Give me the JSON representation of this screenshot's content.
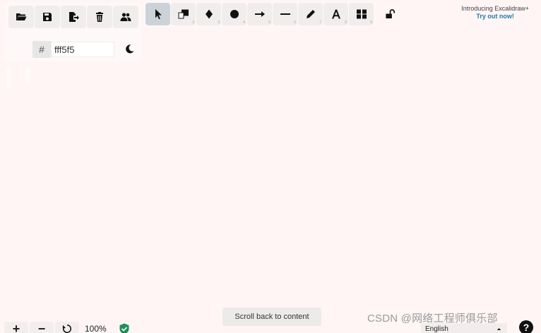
{
  "menu": {
    "buttons": [
      {
        "icon": "folder-open-icon"
      },
      {
        "icon": "save-icon"
      },
      {
        "icon": "export-icon"
      },
      {
        "icon": "trash-icon"
      },
      {
        "icon": "collaborators-icon"
      }
    ],
    "background_color": {
      "hash": "#",
      "value": "fff5f5"
    },
    "theme_icon": "moon-icon"
  },
  "toolbar": {
    "tools": [
      {
        "icon": "selection-icon",
        "selected": true
      },
      {
        "icon": "rectangle-icon",
        "selected": false
      },
      {
        "icon": "diamond-icon",
        "selected": false
      },
      {
        "icon": "ellipse-icon",
        "selected": false
      },
      {
        "icon": "arrow-icon",
        "selected": false
      },
      {
        "icon": "line-icon",
        "selected": false
      },
      {
        "icon": "pencil-icon",
        "selected": false
      },
      {
        "icon": "text-icon",
        "selected": false
      },
      {
        "icon": "library-icon",
        "selected": false
      }
    ],
    "lock_icon": "unlock-icon"
  },
  "promo": {
    "line1": "Introducing Excalidraw+",
    "line2": "Try out now!"
  },
  "footer": {
    "zoom_in": "+",
    "zoom_out": "−",
    "zoom_level": "100%",
    "scroll_back": "Scroll back to content",
    "watermark": "CSDN @网络工程师俱乐部",
    "language": "English",
    "help": "?"
  },
  "colors": {
    "canvas": "#fff5f5",
    "selected_tool": "#ccd3d8",
    "promo_link": "#1f7aa8"
  }
}
